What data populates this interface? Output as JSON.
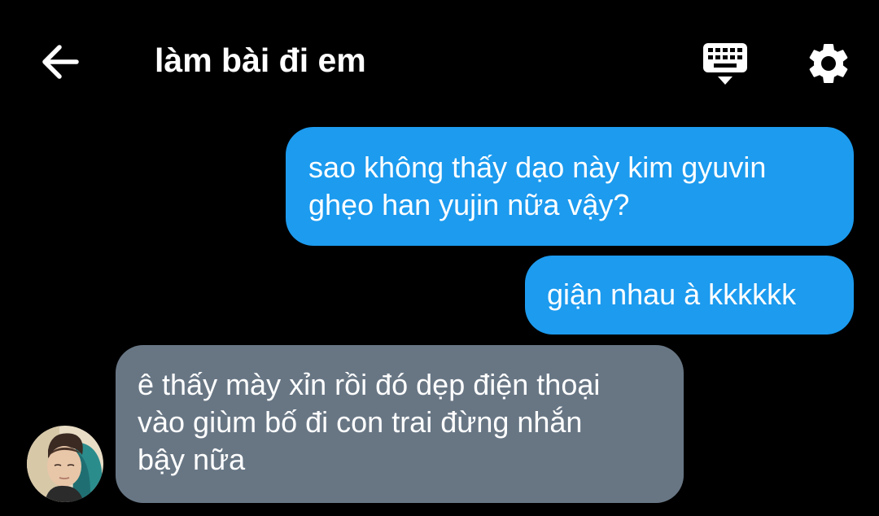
{
  "header": {
    "title": "làm bài đi em",
    "back_icon": "arrow-left-icon",
    "keyboard_icon": "keyboard-hide-icon",
    "settings_icon": "gear-icon"
  },
  "messages": [
    {
      "direction": "outgoing",
      "lines": [
        "sao không thấy dạo này kim gyuvin",
        "ghẹo han yujin nữa vậy?"
      ]
    },
    {
      "direction": "outgoing",
      "lines": [
        "giận nhau à kkkkkk"
      ]
    },
    {
      "direction": "incoming",
      "lines": [
        "ê thấy mày xỉn rồi đó dẹp điện thoại",
        "vào giùm bố đi con trai đừng nhắn",
        "bậy nữa"
      ]
    }
  ],
  "colors": {
    "background": "#000000",
    "outgoing_bubble": "#1c9bef",
    "incoming_bubble": "#687684",
    "text": "#ffffff"
  }
}
